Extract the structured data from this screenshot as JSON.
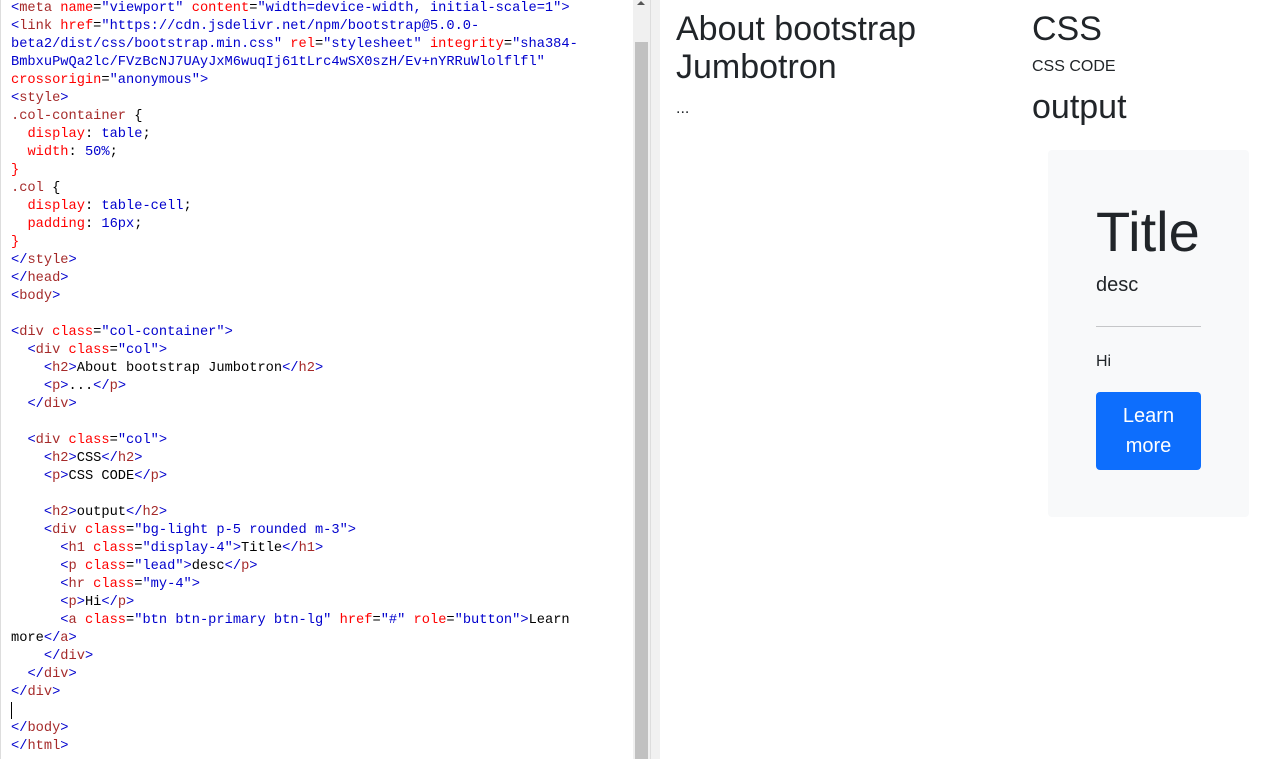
{
  "editor": {
    "lines": [
      [
        [
          "b",
          "<"
        ],
        [
          "n",
          "meta "
        ],
        [
          "a",
          "name"
        ],
        [
          "p",
          "="
        ],
        [
          "v",
          "\"viewport\" "
        ],
        [
          "a",
          "content"
        ],
        [
          "p",
          "="
        ],
        [
          "v",
          "\"width=device-width, initial-scale=1\""
        ],
        [
          "b",
          ">"
        ]
      ],
      [
        [
          "b",
          "<"
        ],
        [
          "n",
          "link "
        ],
        [
          "a",
          "href"
        ],
        [
          "p",
          "="
        ],
        [
          "v",
          "\"https://cdn.jsdelivr.net/npm/bootstrap@5.0.0-"
        ]
      ],
      [
        [
          "v",
          "beta2/dist/css/bootstrap.min.css\" "
        ],
        [
          "a",
          "rel"
        ],
        [
          "p",
          "="
        ],
        [
          "v",
          "\"stylesheet\" "
        ],
        [
          "a",
          "integrity"
        ],
        [
          "p",
          "="
        ],
        [
          "v",
          "\"sha384-"
        ]
      ],
      [
        [
          "v",
          "BmbxuPwQa2lc/FVzBcNJ7UAyJxM6wuqIj61tLrc4wSX0szH/Ev+nYRRuWlolflfl\""
        ]
      ],
      [
        [
          "a",
          "crossorigin"
        ],
        [
          "p",
          "="
        ],
        [
          "v",
          "\"anonymous\""
        ],
        [
          "b",
          ">"
        ]
      ],
      [
        [
          "b",
          "<"
        ],
        [
          "n",
          "style"
        ],
        [
          "b",
          ">"
        ]
      ],
      [
        [
          "s",
          ".col-container "
        ],
        [
          "p",
          "{"
        ]
      ],
      [
        [
          "p",
          "  "
        ],
        [
          "k",
          "display"
        ],
        [
          "p",
          ": "
        ],
        [
          "v",
          "table"
        ],
        [
          "p",
          ";"
        ]
      ],
      [
        [
          "p",
          "  "
        ],
        [
          "k",
          "width"
        ],
        [
          "p",
          ": "
        ],
        [
          "v",
          "50%"
        ],
        [
          "p",
          ";"
        ]
      ],
      [
        [
          "a",
          "}"
        ]
      ],
      [
        [
          "s",
          ".col "
        ],
        [
          "p",
          "{"
        ]
      ],
      [
        [
          "p",
          "  "
        ],
        [
          "k",
          "display"
        ],
        [
          "p",
          ": "
        ],
        [
          "v",
          "table-cell"
        ],
        [
          "p",
          ";"
        ]
      ],
      [
        [
          "p",
          "  "
        ],
        [
          "k",
          "padding"
        ],
        [
          "p",
          ": "
        ],
        [
          "v",
          "16px"
        ],
        [
          "p",
          ";"
        ]
      ],
      [
        [
          "a",
          "}"
        ]
      ],
      [
        [
          "b",
          "</"
        ],
        [
          "n",
          "style"
        ],
        [
          "b",
          ">"
        ]
      ],
      [
        [
          "b",
          "</"
        ],
        [
          "n",
          "head"
        ],
        [
          "b",
          ">"
        ]
      ],
      [
        [
          "b",
          "<"
        ],
        [
          "n",
          "body"
        ],
        [
          "b",
          ">"
        ]
      ],
      [],
      [
        [
          "b",
          "<"
        ],
        [
          "n",
          "div "
        ],
        [
          "a",
          "class"
        ],
        [
          "p",
          "="
        ],
        [
          "v",
          "\"col-container\""
        ],
        [
          "b",
          ">"
        ]
      ],
      [
        [
          "p",
          "  "
        ],
        [
          "b",
          "<"
        ],
        [
          "n",
          "div "
        ],
        [
          "a",
          "class"
        ],
        [
          "p",
          "="
        ],
        [
          "v",
          "\"col\""
        ],
        [
          "b",
          ">"
        ]
      ],
      [
        [
          "p",
          "    "
        ],
        [
          "b",
          "<"
        ],
        [
          "n",
          "h2"
        ],
        [
          "b",
          ">"
        ],
        [
          "p",
          "About bootstrap Jumbotron"
        ],
        [
          "b",
          "</"
        ],
        [
          "n",
          "h2"
        ],
        [
          "b",
          ">"
        ]
      ],
      [
        [
          "p",
          "    "
        ],
        [
          "b",
          "<"
        ],
        [
          "n",
          "p"
        ],
        [
          "b",
          ">"
        ],
        [
          "p",
          "..."
        ],
        [
          "b",
          "</"
        ],
        [
          "n",
          "p"
        ],
        [
          "b",
          ">"
        ]
      ],
      [
        [
          "p",
          "  "
        ],
        [
          "b",
          "</"
        ],
        [
          "n",
          "div"
        ],
        [
          "b",
          ">"
        ]
      ],
      [],
      [
        [
          "p",
          "  "
        ],
        [
          "b",
          "<"
        ],
        [
          "n",
          "div "
        ],
        [
          "a",
          "class"
        ],
        [
          "p",
          "="
        ],
        [
          "v",
          "\"col\""
        ],
        [
          "b",
          ">"
        ]
      ],
      [
        [
          "p",
          "    "
        ],
        [
          "b",
          "<"
        ],
        [
          "n",
          "h2"
        ],
        [
          "b",
          ">"
        ],
        [
          "p",
          "CSS"
        ],
        [
          "b",
          "</"
        ],
        [
          "n",
          "h2"
        ],
        [
          "b",
          ">"
        ]
      ],
      [
        [
          "p",
          "    "
        ],
        [
          "b",
          "<"
        ],
        [
          "n",
          "p"
        ],
        [
          "b",
          ">"
        ],
        [
          "p",
          "CSS CODE"
        ],
        [
          "b",
          "</"
        ],
        [
          "n",
          "p"
        ],
        [
          "b",
          ">"
        ]
      ],
      [],
      [
        [
          "p",
          "    "
        ],
        [
          "b",
          "<"
        ],
        [
          "n",
          "h2"
        ],
        [
          "b",
          ">"
        ],
        [
          "p",
          "output"
        ],
        [
          "b",
          "</"
        ],
        [
          "n",
          "h2"
        ],
        [
          "b",
          ">"
        ]
      ],
      [
        [
          "p",
          "    "
        ],
        [
          "b",
          "<"
        ],
        [
          "n",
          "div "
        ],
        [
          "a",
          "class"
        ],
        [
          "p",
          "="
        ],
        [
          "v",
          "\"bg-light p-5 rounded m-3\""
        ],
        [
          "b",
          ">"
        ]
      ],
      [
        [
          "p",
          "      "
        ],
        [
          "b",
          "<"
        ],
        [
          "n",
          "h1 "
        ],
        [
          "a",
          "class"
        ],
        [
          "p",
          "="
        ],
        [
          "v",
          "\"display-4\""
        ],
        [
          "b",
          ">"
        ],
        [
          "p",
          "Title"
        ],
        [
          "b",
          "</"
        ],
        [
          "n",
          "h1"
        ],
        [
          "b",
          ">"
        ]
      ],
      [
        [
          "p",
          "      "
        ],
        [
          "b",
          "<"
        ],
        [
          "n",
          "p "
        ],
        [
          "a",
          "class"
        ],
        [
          "p",
          "="
        ],
        [
          "v",
          "\"lead\""
        ],
        [
          "b",
          ">"
        ],
        [
          "p",
          "desc"
        ],
        [
          "b",
          "</"
        ],
        [
          "n",
          "p"
        ],
        [
          "b",
          ">"
        ]
      ],
      [
        [
          "p",
          "      "
        ],
        [
          "b",
          "<"
        ],
        [
          "n",
          "hr "
        ],
        [
          "a",
          "class"
        ],
        [
          "p",
          "="
        ],
        [
          "v",
          "\"my-4\""
        ],
        [
          "b",
          ">"
        ]
      ],
      [
        [
          "p",
          "      "
        ],
        [
          "b",
          "<"
        ],
        [
          "n",
          "p"
        ],
        [
          "b",
          ">"
        ],
        [
          "p",
          "Hi"
        ],
        [
          "b",
          "</"
        ],
        [
          "n",
          "p"
        ],
        [
          "b",
          ">"
        ]
      ],
      [
        [
          "p",
          "      "
        ],
        [
          "b",
          "<"
        ],
        [
          "n",
          "a "
        ],
        [
          "a",
          "class"
        ],
        [
          "p",
          "="
        ],
        [
          "v",
          "\"btn btn-primary btn-lg\" "
        ],
        [
          "a",
          "href"
        ],
        [
          "p",
          "="
        ],
        [
          "v",
          "\"#\" "
        ],
        [
          "a",
          "role"
        ],
        [
          "p",
          "="
        ],
        [
          "v",
          "\"button\""
        ],
        [
          "b",
          ">"
        ],
        [
          "p",
          "Learn"
        ]
      ],
      [
        [
          "p",
          "more"
        ],
        [
          "b",
          "</"
        ],
        [
          "n",
          "a"
        ],
        [
          "b",
          ">"
        ]
      ],
      [
        [
          "p",
          "    "
        ],
        [
          "b",
          "</"
        ],
        [
          "n",
          "div"
        ],
        [
          "b",
          ">"
        ]
      ],
      [
        [
          "p",
          "  "
        ],
        [
          "b",
          "</"
        ],
        [
          "n",
          "div"
        ],
        [
          "b",
          ">"
        ]
      ],
      [
        [
          "b",
          "</"
        ],
        [
          "n",
          "div"
        ],
        [
          "b",
          ">"
        ]
      ],
      [],
      [
        [
          "b",
          "</"
        ],
        [
          "n",
          "body"
        ],
        [
          "b",
          ">"
        ]
      ],
      [
        [
          "b",
          "</"
        ],
        [
          "n",
          "html"
        ],
        [
          "b",
          ">"
        ]
      ]
    ]
  },
  "preview": {
    "col1": {
      "heading": "About bootstrap Jumbotron",
      "text": "..."
    },
    "col2": {
      "heading": "CSS",
      "text": "CSS CODE",
      "output_heading": "output"
    },
    "jumbotron": {
      "title": "Title",
      "lead": "desc",
      "body": "Hi",
      "button_label": "Learn more"
    }
  },
  "colors": {
    "primary": "#0d6efd",
    "bg_light": "#f8f9fa"
  }
}
